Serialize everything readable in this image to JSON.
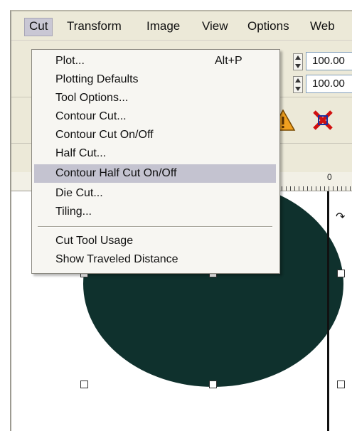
{
  "menubar": {
    "items": [
      "Cut",
      "Transform",
      "Image",
      "View",
      "Options",
      "Web"
    ]
  },
  "toolbar": {
    "field1": "100.00",
    "field2": "100.00"
  },
  "cut_menu": {
    "items": [
      {
        "label": "Plot...",
        "shortcut": "Alt+P"
      },
      {
        "label": "Plotting Defaults",
        "shortcut": ""
      },
      {
        "label": "Tool Options...",
        "shortcut": ""
      },
      {
        "label": "Contour Cut...",
        "shortcut": ""
      },
      {
        "label": "Contour Cut On/Off",
        "shortcut": ""
      },
      {
        "label": "Half Cut...",
        "shortcut": ""
      },
      {
        "label": "Contour Half Cut On/Off",
        "shortcut": "",
        "highlighted": true
      },
      {
        "label": "Die Cut...",
        "shortcut": ""
      },
      {
        "label": "Tiling...",
        "shortcut": ""
      }
    ],
    "items2": [
      {
        "label": "Cut Tool Usage"
      },
      {
        "label": "Show Traveled Distance"
      }
    ]
  },
  "ruler": {
    "label_a": "0",
    "label_b": "0"
  },
  "colors": {
    "shape_fill": "#0f312d",
    "highlight": "#c4c3d0"
  }
}
